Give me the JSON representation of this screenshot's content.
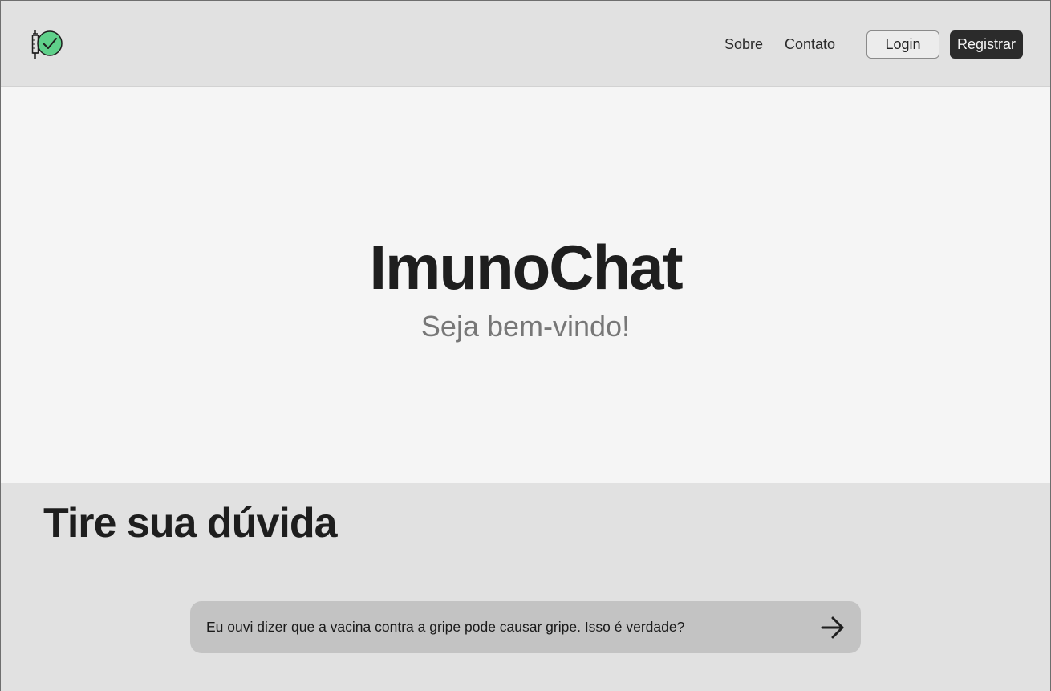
{
  "header": {
    "logo_icon": "syringe-check-icon",
    "nav": {
      "sobre": "Sobre",
      "contato": "Contato"
    },
    "login_label": "Login",
    "register_label": "Registrar"
  },
  "hero": {
    "title": "ImunoChat",
    "subtitle": "Seja bem-vindo!"
  },
  "question": {
    "section_title": "Tire sua dúvida",
    "input_value": "Eu ouvi dizer que a vacina contra a gripe pode causar gripe. Isso é verdade?",
    "send_icon": "arrow-right-icon"
  },
  "colors": {
    "header_bg": "#e1e1e1",
    "hero_bg": "#f5f5f5",
    "accent_green": "#5fd08a",
    "dark_button": "#2b2b2b",
    "input_bg": "#c3c3c3"
  }
}
